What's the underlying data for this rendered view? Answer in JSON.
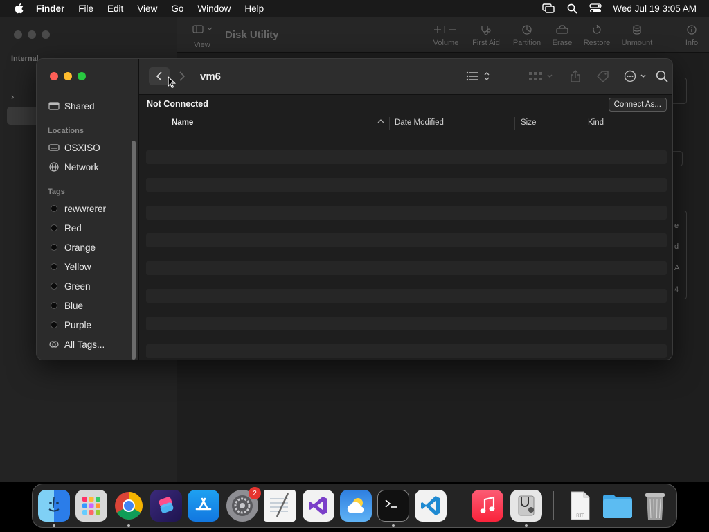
{
  "menubar": {
    "app_name": "Finder",
    "menus": [
      "File",
      "Edit",
      "View",
      "Go",
      "Window",
      "Help"
    ],
    "clock": "Wed Jul 19  3:05 AM"
  },
  "disk_utility": {
    "title": "Disk Utility",
    "view_label": "View",
    "sidebar_section": "Internal",
    "tools": [
      "Volume",
      "First Aid",
      "Partition",
      "Erase",
      "Restore",
      "Unmount",
      "Info"
    ],
    "right_snippets": [
      "e",
      "d",
      "A",
      "4"
    ]
  },
  "finder": {
    "title": "vm6",
    "status": "Not Connected",
    "connect_button": "Connect As...",
    "sidebar": {
      "shared": "Shared",
      "locations_header": "Locations",
      "locations": [
        "OSXISO",
        "Network"
      ],
      "tags_header": "Tags",
      "tags": [
        "rewwrerer",
        "Red",
        "Orange",
        "Yellow",
        "Green",
        "Blue",
        "Purple"
      ],
      "all_tags": "All Tags..."
    },
    "columns": [
      "Name",
      "Date Modified",
      "Size",
      "Kind"
    ],
    "sort_column": "Name",
    "sort_direction": "ascending",
    "file_rows": 0
  },
  "dock": {
    "apps": [
      "finder-icon",
      "launchpad-icon",
      "chrome-icon",
      "shortcuts-icon",
      "app-store-icon",
      "system-settings-icon",
      "textedit-icon",
      "visual-studio-icon",
      "weather-icon",
      "terminal-icon",
      "vscode-icon",
      "music-icon",
      "disk-utility-icon",
      "document-icon",
      "downloads-folder-icon",
      "trash-icon"
    ],
    "settings_badge": "2",
    "document_label": "RTF"
  }
}
